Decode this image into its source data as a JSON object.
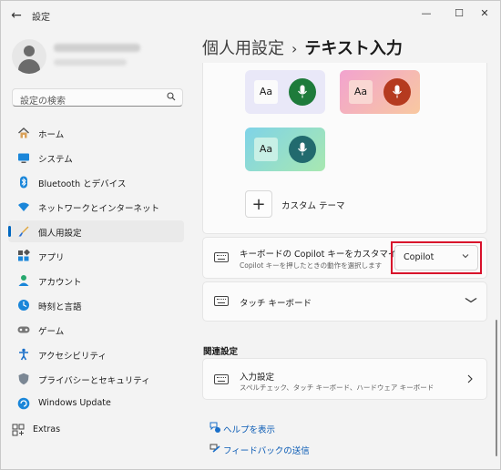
{
  "window": {
    "app_title": "設定",
    "controls": {
      "minimize": "—",
      "maximize": "☐",
      "close": "✕"
    }
  },
  "search": {
    "placeholder": "設定の検索"
  },
  "nav": [
    {
      "label": "ホーム",
      "icon": "home-icon",
      "active": false
    },
    {
      "label": "システム",
      "icon": "system-icon",
      "active": false
    },
    {
      "label": "Bluetooth とデバイス",
      "icon": "bluetooth-icon",
      "active": false
    },
    {
      "label": "ネットワークとインターネット",
      "icon": "network-icon",
      "active": false
    },
    {
      "label": "個人用設定",
      "icon": "brush-icon",
      "active": true
    },
    {
      "label": "アプリ",
      "icon": "apps-icon",
      "active": false
    },
    {
      "label": "アカウント",
      "icon": "account-icon",
      "active": false
    },
    {
      "label": "時刻と言語",
      "icon": "time-language-icon",
      "active": false
    },
    {
      "label": "ゲーム",
      "icon": "gaming-icon",
      "active": false
    },
    {
      "label": "アクセシビリティ",
      "icon": "accessibility-icon",
      "active": false
    },
    {
      "label": "プライバシーとセキュリティ",
      "icon": "shield-icon",
      "active": false
    },
    {
      "label": "Windows Update",
      "icon": "windows-update-icon",
      "active": false
    },
    {
      "label": "Extras",
      "icon": "extras-icon",
      "active": false
    }
  ],
  "header": {
    "breadcrumb_parent": "個人用設定",
    "separator": "›",
    "current": "テキスト入力"
  },
  "themes": {
    "sample_text": "Aa",
    "items": [
      {
        "id": "lavender-green",
        "bg": "#e9e8f8",
        "mic_color": "#1e7b3b"
      },
      {
        "id": "pink-orange",
        "bg": "#f7b6a6",
        "mic_color": "#b53a1f"
      },
      {
        "id": "teal-green",
        "bg": "#7fdcc3",
        "mic_color": "#226a6e"
      }
    ],
    "custom_plus": "+",
    "custom_label": "カスタム テーマ"
  },
  "copilot_row": {
    "title": "キーボードの Copilot キーをカスタマイズする",
    "subtitle": "Copilot キーを押したときの動作を選択します",
    "selected": "Copilot",
    "chevron": "⌄"
  },
  "touch_keyboard_row": {
    "title": "タッチ キーボード",
    "chevron": "⌄"
  },
  "related": {
    "section_title": "関連設定",
    "input_settings": {
      "title": "入力設定",
      "subtitle": "スペルチェック、タッチ キーボード、ハードウェア キーボード",
      "chevron": "›"
    }
  },
  "links": {
    "help": "ヘルプを表示",
    "feedback": "フィードバックの送信"
  },
  "colors": {
    "accent": "#0067c0",
    "highlight": "#d8102b",
    "link": "#0a5bb5"
  }
}
